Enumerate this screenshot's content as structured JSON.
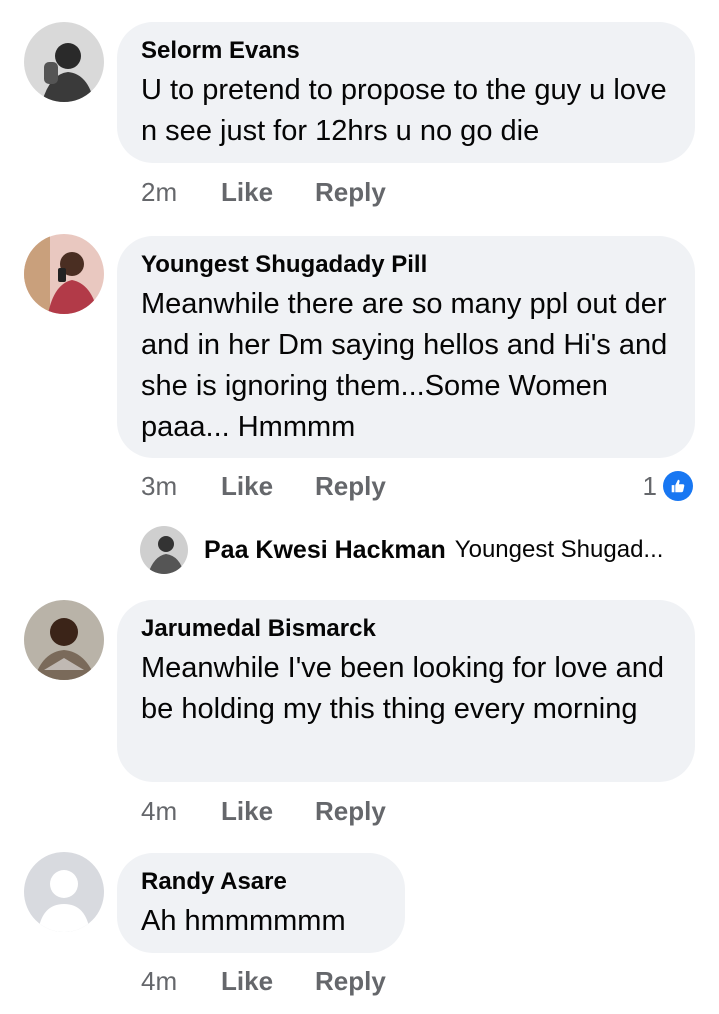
{
  "comments": [
    {
      "author": "Selorm Evans",
      "text": "U to pretend to propose to the guy u love n see just for 12hrs u no go die",
      "time": "2m",
      "like_label": "Like",
      "reply_label": "Reply"
    },
    {
      "author": "Youngest Shugadady Pill",
      "text": "Meanwhile there are so many ppl out der and in her Dm saying hellos and Hi's and she is ignoring them...Some Women paaa... Hmmmm",
      "time": "3m",
      "like_label": "Like",
      "reply_label": "Reply",
      "reaction_count": "1",
      "reply": {
        "author": "Paa Kwesi Hackman",
        "snippet": "Youngest Shugad..."
      }
    },
    {
      "author": "Jarumedal Bismarck",
      "text": "Meanwhile I've been looking for love and be holding my this thing every morning",
      "time": "4m",
      "like_label": "Like",
      "reply_label": "Reply"
    },
    {
      "author": "Randy Asare",
      "text": "Ah hmmmmmm",
      "time": "4m",
      "like_label": "Like",
      "reply_label": "Reply"
    }
  ],
  "colors": {
    "bubble": "#f0f2f5",
    "secondary_text": "#65676b",
    "like_blue": "#1877f2"
  }
}
